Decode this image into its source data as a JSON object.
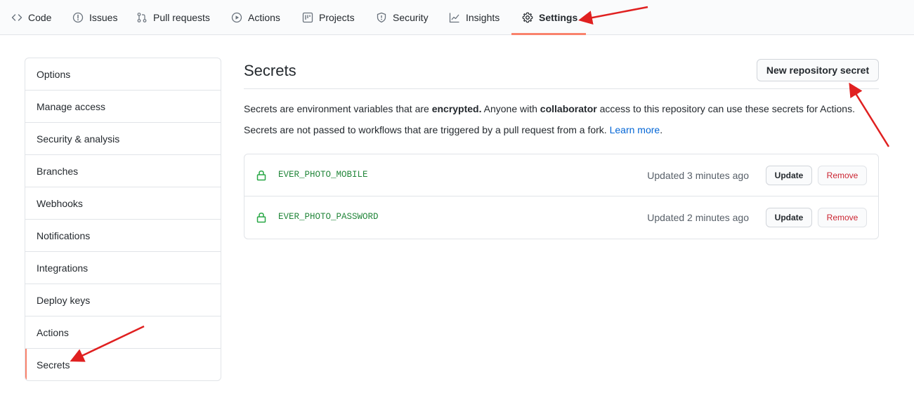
{
  "nav": {
    "tabs": [
      {
        "label": "Code",
        "icon": "code-icon"
      },
      {
        "label": "Issues",
        "icon": "issue-icon"
      },
      {
        "label": "Pull requests",
        "icon": "pull-request-icon"
      },
      {
        "label": "Actions",
        "icon": "play-icon"
      },
      {
        "label": "Projects",
        "icon": "project-icon"
      },
      {
        "label": "Security",
        "icon": "shield-icon"
      },
      {
        "label": "Insights",
        "icon": "graph-icon"
      },
      {
        "label": "Settings",
        "icon": "gear-icon",
        "selected": true
      }
    ]
  },
  "sidebar": {
    "items": [
      {
        "label": "Options"
      },
      {
        "label": "Manage access"
      },
      {
        "label": "Security & analysis"
      },
      {
        "label": "Branches"
      },
      {
        "label": "Webhooks"
      },
      {
        "label": "Notifications"
      },
      {
        "label": "Integrations"
      },
      {
        "label": "Deploy keys"
      },
      {
        "label": "Actions"
      },
      {
        "label": "Secrets",
        "active": true
      }
    ]
  },
  "main": {
    "title": "Secrets",
    "new_button": "New repository secret",
    "desc1": {
      "part1": "Secrets are environment variables that are ",
      "bold1": "encrypted.",
      "part2": " Anyone with ",
      "bold2": "collaborator",
      "part3": " access to this repository can use these secrets for Actions."
    },
    "desc2": {
      "text": "Secrets are not passed to workflows that are triggered by a pull request from a fork. ",
      "link": "Learn more",
      "end": "."
    },
    "secrets": [
      {
        "name": "EVER_PHOTO_MOBILE",
        "updated": "Updated 3 minutes ago",
        "update_label": "Update",
        "remove_label": "Remove"
      },
      {
        "name": "EVER_PHOTO_PASSWORD",
        "updated": "Updated 2 minutes ago",
        "update_label": "Update",
        "remove_label": "Remove"
      }
    ]
  },
  "colors": {
    "accent_underline": "#f9826c",
    "secret_green": "#22863a",
    "remove_red": "#cb2431",
    "annotation_arrow": "#e02020",
    "link_blue": "#0366d6"
  }
}
